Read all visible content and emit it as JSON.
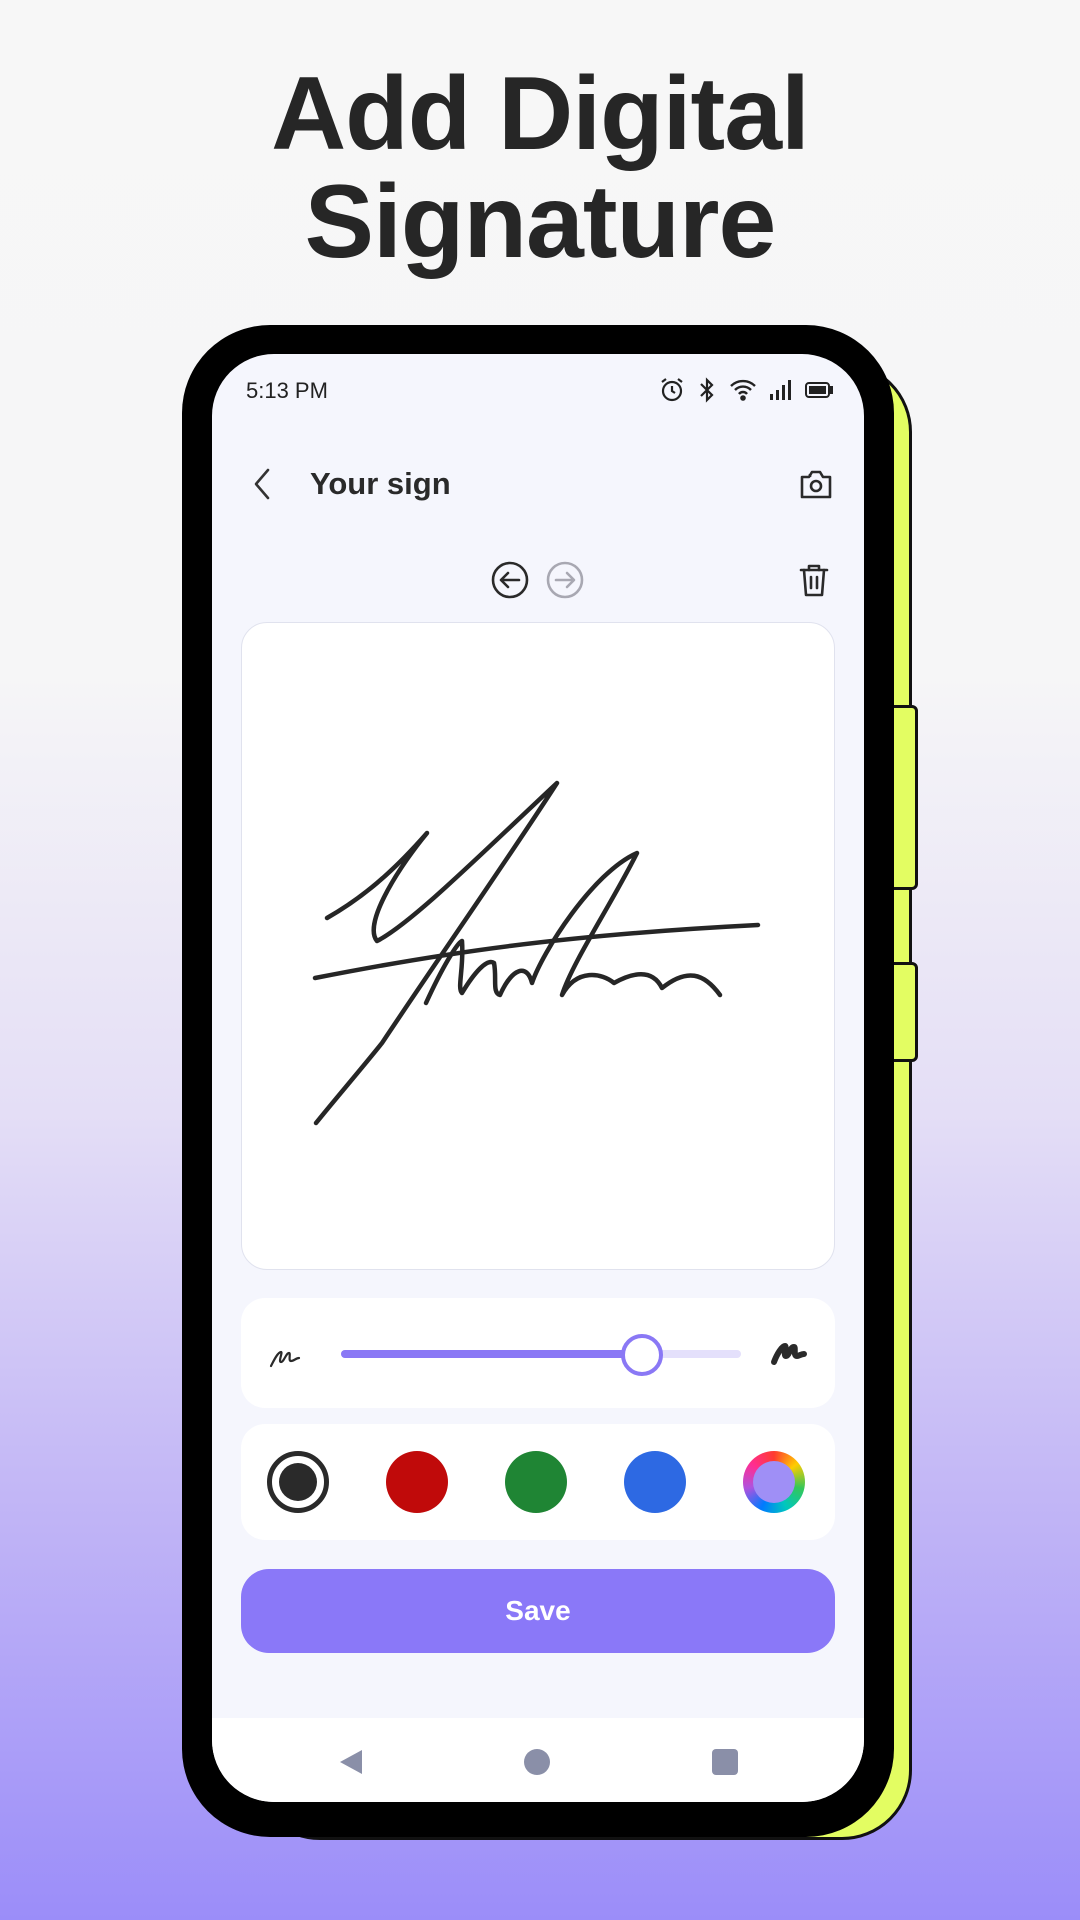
{
  "promo": {
    "headline_line1": "Add Digital",
    "headline_line2": "Signature"
  },
  "status_bar": {
    "time": "5:13 PM",
    "icons": [
      "alarm-icon",
      "bluetooth-icon",
      "wifi-icon",
      "signal-icon",
      "battery-icon"
    ]
  },
  "header": {
    "back_icon": "chevron-left-icon",
    "title": "Your sign",
    "camera_icon": "camera-icon"
  },
  "toolbar": {
    "undo_icon": "undo-arrow-icon",
    "redo_icon": "redo-arrow-icon",
    "redo_enabled": false,
    "delete_icon": "trash-icon"
  },
  "pen": {
    "thickness_percent": 75,
    "thin_icon": "thin-stroke-icon",
    "thick_icon": "thick-stroke-icon"
  },
  "colors": {
    "selected": "black",
    "swatches": [
      {
        "name": "black",
        "hex": "#2a2a2a"
      },
      {
        "name": "red",
        "hex": "#c00a0a"
      },
      {
        "name": "green",
        "hex": "#1f8534"
      },
      {
        "name": "blue",
        "hex": "#2d69e3"
      },
      {
        "name": "custom",
        "hex": "#9f8ff6"
      }
    ]
  },
  "actions": {
    "save_label": "Save"
  },
  "theme": {
    "accent": "#8a78f8",
    "phone_accent": "#e3fd62"
  },
  "navbar": {
    "icons": [
      "nav-back-icon",
      "nav-home-icon",
      "nav-recents-icon"
    ]
  }
}
